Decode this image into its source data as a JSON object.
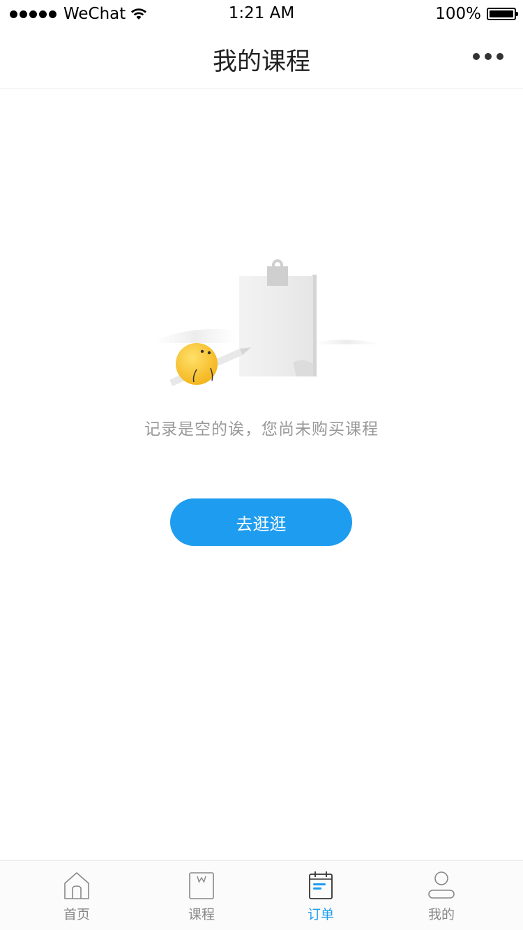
{
  "status_bar": {
    "carrier": "WeChat",
    "time": "1:21 AM",
    "battery": "100%"
  },
  "nav": {
    "title": "我的课程",
    "more_icon": "more-dots-icon"
  },
  "empty_state": {
    "message": "记录是空的诶，您尚未购买课程",
    "button_label": "去逛逛",
    "illustration": "empty-clipboard-illustration"
  },
  "tab_bar": {
    "active": "订单",
    "items": [
      {
        "label": "首页",
        "icon": "home-icon"
      },
      {
        "label": "课程",
        "icon": "course-book-icon"
      },
      {
        "label": "订单",
        "icon": "order-notepad-icon"
      },
      {
        "label": "我的",
        "icon": "profile-user-icon"
      }
    ]
  },
  "colors": {
    "accent": "#1e9cf0",
    "text_muted": "#999999",
    "tab_inactive": "#888888"
  }
}
